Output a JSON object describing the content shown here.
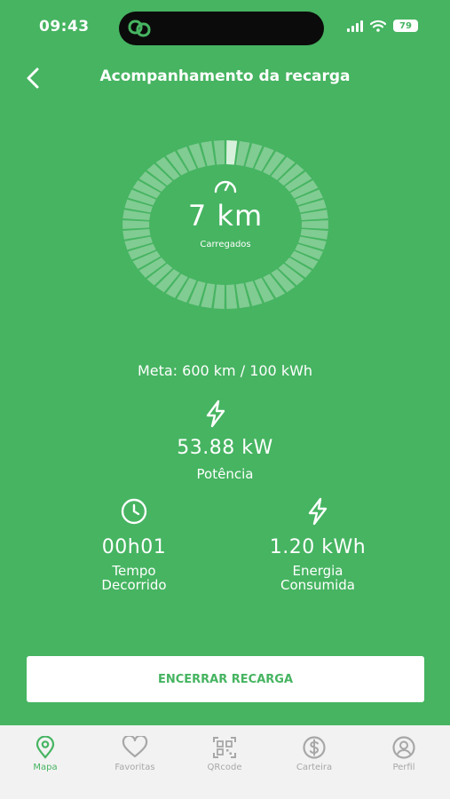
{
  "status": {
    "time": "09:43",
    "battery": "79"
  },
  "header": {
    "title": "Acompanhamento da recarga"
  },
  "gauge": {
    "value": "7 km",
    "label": "Carregados",
    "progress": 0.012
  },
  "goal": "Meta: 600 km / 100 kWh",
  "power": {
    "value": "53.88 kW",
    "label": "Potência"
  },
  "time_elapsed": {
    "value": "00h01",
    "label_line1": "Tempo",
    "label_line2": "Decorrido"
  },
  "energy": {
    "value": "1.20 kWh",
    "label_line1": "Energia",
    "label_line2": "Consumida"
  },
  "actions": {
    "end_label": "ENCERRAR RECARGA"
  },
  "tabs": [
    {
      "label": "Mapa",
      "icon": "map-pin-icon",
      "active": true
    },
    {
      "label": "Favoritas",
      "icon": "heart-icon",
      "active": false
    },
    {
      "label": "QRcode",
      "icon": "qrcode-icon",
      "active": false
    },
    {
      "label": "Carteira",
      "icon": "dollar-icon",
      "active": false
    },
    {
      "label": "Perfil",
      "icon": "user-icon",
      "active": false
    }
  ],
  "colors": {
    "background": "#46b461",
    "button_text": "#46b461",
    "tabbar": "#f2f2f2",
    "tab_inactive": "#a7a7a7"
  }
}
